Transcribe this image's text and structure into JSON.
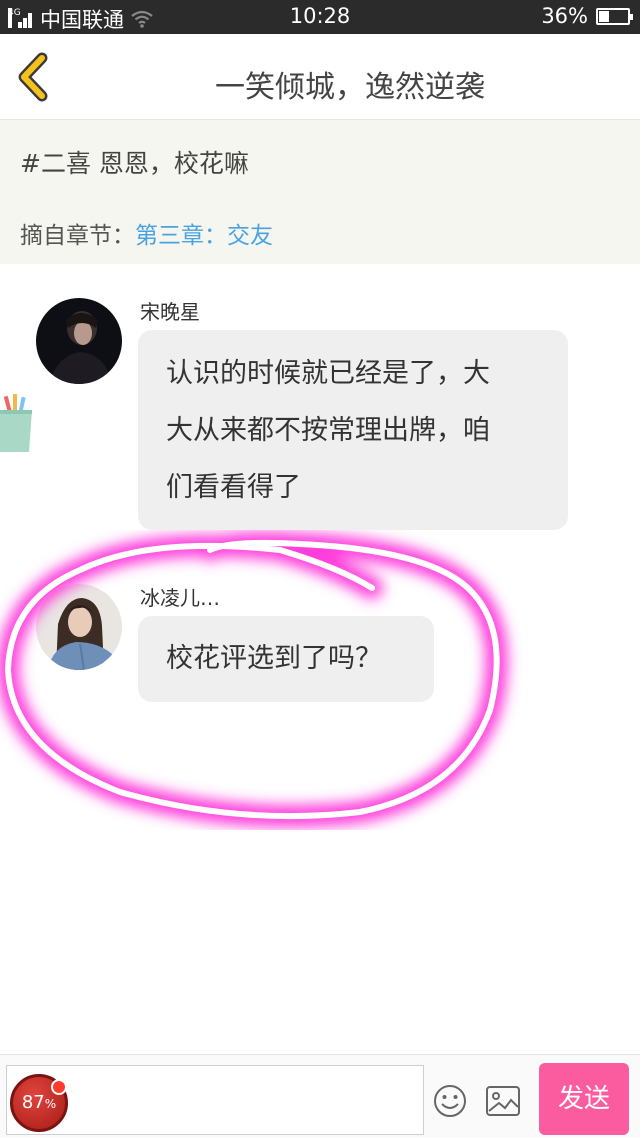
{
  "status_bar": {
    "network_type": "4G",
    "carrier": "中国联通",
    "time": "10:28",
    "battery": "36%",
    "battery_level": 0.36
  },
  "nav": {
    "title": "一笑倾城，逸然逆袭",
    "back_icon": "chevron-left-icon"
  },
  "quote": {
    "text": "#二喜 恩恩，校花嘛",
    "chapter_label": "摘自章节：",
    "chapter_link": "第三章：交友"
  },
  "messages": [
    {
      "sender": "宋晚星",
      "lines": [
        "认识的时候就已经是了，大",
        "大从来都不按常理出牌，咱",
        "们看看得了"
      ]
    },
    {
      "sender": "冰凌儿…",
      "lines": [
        "校花评选到了吗？"
      ]
    }
  ],
  "input_bar": {
    "input_value": "",
    "emoji_icon": "smiley-icon",
    "image_icon": "image-icon",
    "send_label": "发送"
  },
  "float_badge": {
    "value": "87",
    "unit": "%"
  },
  "colors": {
    "accent_pink": "#fb5b9f",
    "link_blue": "#4aa3df",
    "back_arrow_yellow": "#f4c21a",
    "bubble_gray": "#efefef",
    "annotation_pink": "#ff3cdc"
  }
}
